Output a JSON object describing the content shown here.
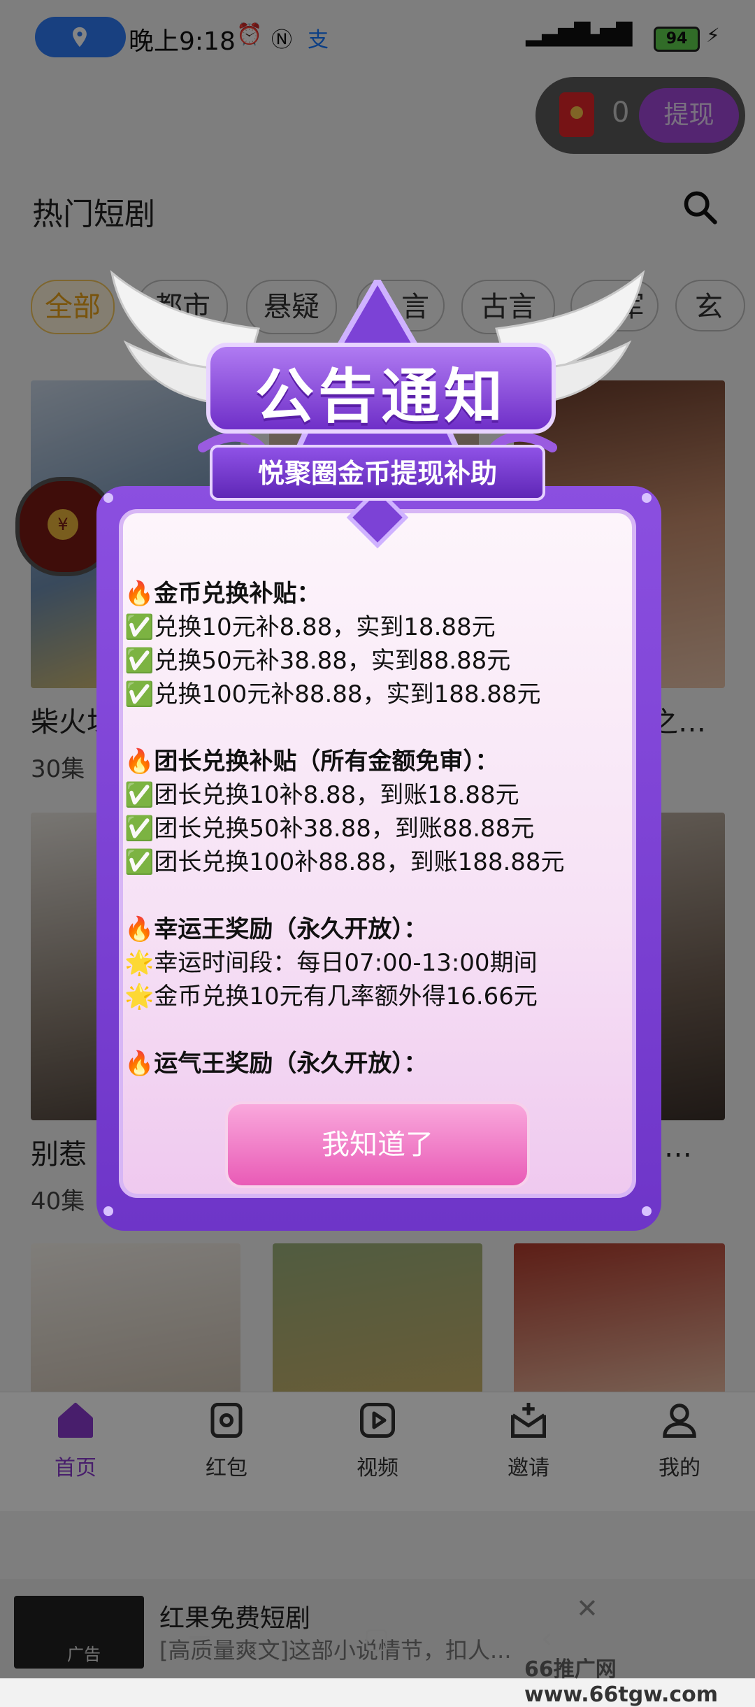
{
  "status_bar": {
    "time": "晚上9:18",
    "battery": "94"
  },
  "wallet": {
    "count": "0",
    "withdraw_label": "提现"
  },
  "page": {
    "section_title": "热门短剧"
  },
  "categories": [
    "全部",
    "都市",
    "悬疑",
    "言",
    "古言",
    "军",
    "玄"
  ],
  "cards": [
    {
      "title": "柴火垛",
      "episodes": "30集"
    },
    {
      "title": "之…",
      "episodes": ""
    },
    {
      "title": "别惹",
      "episodes": "40集"
    },
    {
      "title": "…",
      "episodes": ""
    }
  ],
  "bottom_nav": [
    "首页",
    "红包",
    "视频",
    "邀请",
    "我的"
  ],
  "ad": {
    "thumb_label": "广告",
    "title": "红果免费短剧",
    "desc": "[高质量爽文]这部小说情节，扣人..."
  },
  "watermark": "66推广网www.66tgw.com",
  "modal": {
    "title": "公告通知",
    "subtitle": "悦聚圈金币提现补助",
    "lines": [
      "🔥金币兑换补贴：",
      "✅兑换10元补8.88，实到18.88元",
      "✅兑换50元补38.88，实到88.88元",
      "✅兑换100元补88.88，实到188.88元",
      "",
      "🔥团长兑换补贴（所有金额免审）：",
      "✅团长兑换10补8.88，到账18.88元",
      "✅团长兑换50补38.88，到账88.88元",
      "✅团长兑换100补88.88，到账188.88元",
      "",
      "🔥幸运王奖励（永久开放）：",
      "🌟幸运时间段：每日07:00-13:00期间",
      "🌟金币兑换10元有几率额外得16.66元",
      "",
      "🔥运气王奖励（永久开放）："
    ],
    "ok_label": "我知道了"
  }
}
